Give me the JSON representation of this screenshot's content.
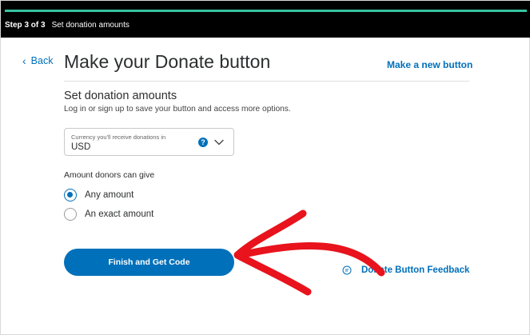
{
  "progress": {
    "fraction": 1.0,
    "color": "#36c4a0",
    "step_count": "Step 3 of 3",
    "step_title": "Set donation amounts"
  },
  "header": {
    "back_label": "Back",
    "back_icon": "chevron-left-icon",
    "title": "Make your Donate button",
    "new_button_label": "Make a new button"
  },
  "section": {
    "title": "Set donation amounts",
    "subtitle": "Log in or sign up to save your button and access more options."
  },
  "currency": {
    "label": "Currency you'll receive donations in",
    "value": "USD",
    "help_icon": "help-icon",
    "help_glyph": "?",
    "dropdown_icon": "chevron-down-icon"
  },
  "amounts": {
    "label": "Amount donors can give",
    "options": [
      {
        "label": "Any amount",
        "selected": true
      },
      {
        "label": "An exact amount",
        "selected": false
      }
    ]
  },
  "actions": {
    "finish_label": "Finish and Get Code",
    "feedback_label": "Donate Button Feedback",
    "feedback_icon": "chat-icon"
  },
  "colors": {
    "accent": "#0070ba",
    "annotation": "#e8131c",
    "topbar": "#000000"
  }
}
